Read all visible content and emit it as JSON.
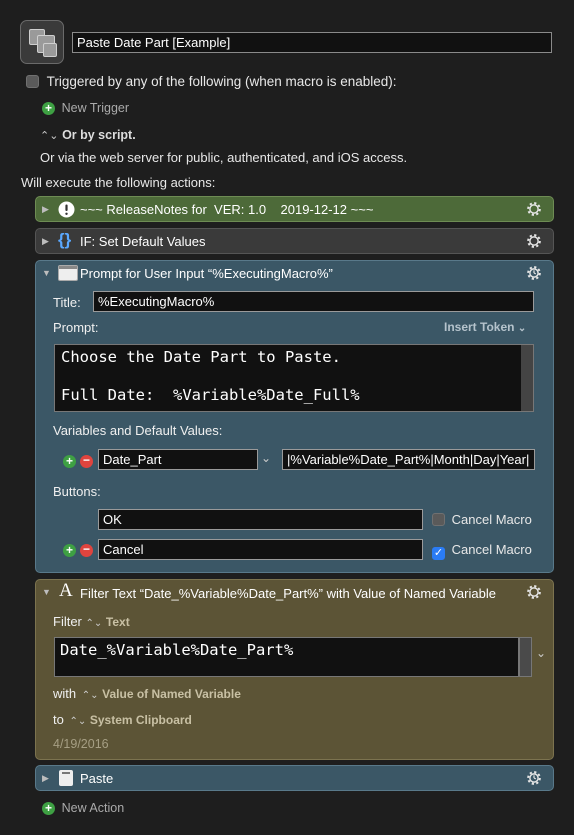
{
  "macro": {
    "name": "Paste Date Part [Example]"
  },
  "triggers": {
    "triggered_label": "Triggered by any of the following (when macro is enabled):",
    "new_trigger": "New Trigger",
    "or_by_script": "Or by script.",
    "web_server": "Or via the web server for public, authenticated, and iOS access."
  },
  "will_execute": "Will execute the following actions:",
  "actions": {
    "release_notes": {
      "title": "~~~ ReleaseNotes for  VER: 1.0    2019-12-12 ~~~"
    },
    "if_action": {
      "title": "IF:  Set Default Values"
    },
    "prompt": {
      "title": "Prompt for User Input “%ExecutingMacro%”",
      "title_label": "Title:",
      "title_value": "%ExecutingMacro%",
      "prompt_label": "Prompt:",
      "insert_token": "Insert Token",
      "prompt_line1": "Choose the Date Part to Paste.",
      "prompt_line2": "Full Date:  %Variable%Date_Full%",
      "variables_label": "Variables and Default Values:",
      "var_name": "Date_Part",
      "var_default": "|%Variable%Date_Part%|Month|Day|Year|",
      "buttons_label": "Buttons:",
      "button1": "OK",
      "button2": "Cancel",
      "cancel_macro_1": "Cancel Macro",
      "cancel_macro_2": "Cancel Macro"
    },
    "filter": {
      "title": "Filter Text “Date_%Variable%Date_Part%” with Value of Named Variable",
      "filter_label": "Filter",
      "filter_kind": "Text",
      "filter_value": "Date_%Variable%Date_Part%",
      "with_label": "with",
      "with_value": "Value of Named Variable",
      "to_label": "to",
      "to_value": "System Clipboard",
      "date": "4/19/2016"
    },
    "paste": {
      "title": "Paste"
    }
  },
  "new_action": "New Action",
  "colors": {
    "green_panel": "#4d6a39",
    "blue_panel": "#3b5766",
    "olive_panel": "#5c5436",
    "background": "#1e1e1e"
  }
}
